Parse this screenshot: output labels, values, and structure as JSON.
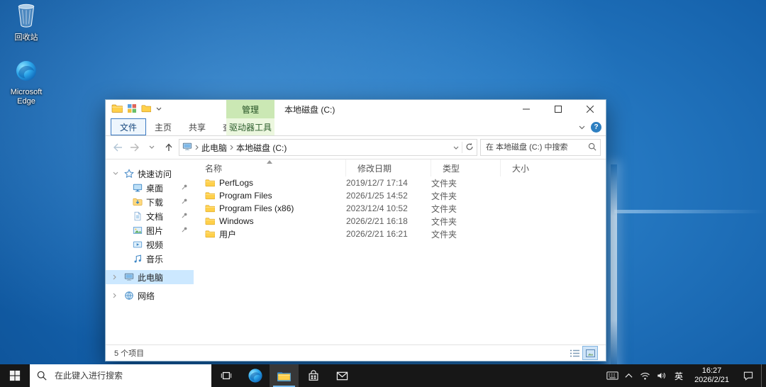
{
  "desktop": {
    "icons": [
      {
        "label": "回收站",
        "icon": "recycle-bin"
      },
      {
        "label": "Microsoft Edge",
        "icon": "edge"
      }
    ]
  },
  "explorer": {
    "titlebar": {
      "contextual_group": "管理",
      "title": "本地磁盘 (C:)"
    },
    "help_label": "?",
    "tabs": [
      {
        "label": "文件"
      },
      {
        "label": "主页"
      },
      {
        "label": "共享"
      },
      {
        "label": "查看"
      },
      {
        "label": "驱动器工具"
      }
    ],
    "address": {
      "crumbs": [
        {
          "label": "此电脑"
        },
        {
          "label": "本地磁盘 (C:)"
        }
      ]
    },
    "search": {
      "placeholder": "在 本地磁盘 (C:) 中搜索"
    },
    "sidebar": {
      "items": [
        {
          "label": "快速访问",
          "icon": "star",
          "level": 0,
          "expanded": true
        },
        {
          "label": "桌面",
          "icon": "desktop",
          "level": 1,
          "pinned": true
        },
        {
          "label": "下载",
          "icon": "download",
          "level": 1,
          "pinned": true
        },
        {
          "label": "文档",
          "icon": "document",
          "level": 1,
          "pinned": true
        },
        {
          "label": "图片",
          "icon": "pictures",
          "level": 1,
          "pinned": true
        },
        {
          "label": "视频",
          "icon": "videos",
          "level": 1,
          "pinned": false
        },
        {
          "label": "音乐",
          "icon": "music",
          "level": 1,
          "pinned": false
        },
        {
          "label": "此电脑",
          "icon": "computer",
          "level": 0,
          "selected": true
        },
        {
          "label": "网络",
          "icon": "network",
          "level": 0
        }
      ]
    },
    "list": {
      "columns": [
        {
          "label": "名称"
        },
        {
          "label": "修改日期"
        },
        {
          "label": "类型"
        },
        {
          "label": "大小"
        }
      ],
      "files": [
        {
          "name": "PerfLogs",
          "date": "2019/12/7 17:14",
          "type": "文件夹",
          "size": ""
        },
        {
          "name": "Program Files",
          "date": "2026/1/25 14:52",
          "type": "文件夹",
          "size": ""
        },
        {
          "name": "Program Files (x86)",
          "date": "2023/12/4 10:52",
          "type": "文件夹",
          "size": ""
        },
        {
          "name": "Windows",
          "date": "2026/2/21 16:18",
          "type": "文件夹",
          "size": ""
        },
        {
          "name": "用户",
          "date": "2026/2/21 16:21",
          "type": "文件夹",
          "size": ""
        }
      ]
    },
    "statusbar": {
      "items_count": "5 个项目"
    }
  },
  "taskbar": {
    "search_placeholder": "在此键入进行搜索",
    "tray": {
      "language": "英",
      "time": "16:27",
      "date": "2026/2/21"
    }
  },
  "colors": {
    "accent": "#0078d7",
    "contextual_tab_green": "#cbe8b4",
    "taskbar": "#171717",
    "selection": "#cce8ff"
  }
}
